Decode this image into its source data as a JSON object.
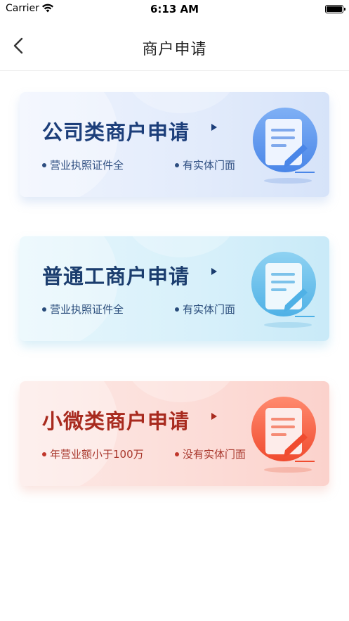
{
  "status_bar": {
    "carrier": "Carrier",
    "time": "6:13 AM"
  },
  "nav": {
    "title": "商户申请"
  },
  "cards": [
    {
      "title": "公司类商户申请",
      "features": [
        "营业执照证件全",
        "有实体门面"
      ],
      "accent": "#1c3e7a",
      "icon": "document-edit-icon"
    },
    {
      "title": "普通工商户申请",
      "features": [
        "营业执照证件全",
        "有实体门面"
      ],
      "accent": "#1b3d6e",
      "icon": "document-edit-icon"
    },
    {
      "title": "小微类商户申请",
      "features": [
        "年营业额小于100万",
        "没有实体门面"
      ],
      "accent": "#a82a1e",
      "icon": "document-edit-icon"
    }
  ]
}
